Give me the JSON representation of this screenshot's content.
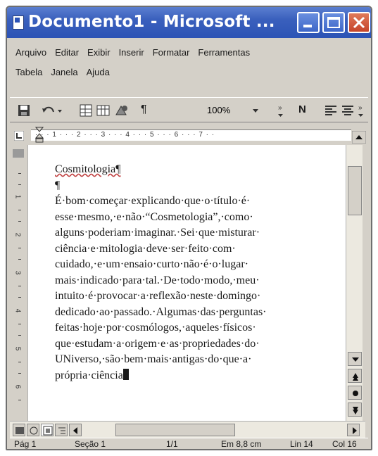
{
  "window": {
    "title": "Documento1 - Microsoft ..."
  },
  "menu": {
    "row1": [
      "Arquivo",
      "Editar",
      "Exibir",
      "Inserir",
      "Formatar",
      "Ferramentas"
    ],
    "row2": [
      "Tabela",
      "Janela",
      "Ajuda"
    ]
  },
  "toolbar": {
    "pilcrow": "¶",
    "zoom": "100%",
    "bold": "N"
  },
  "ruler": {
    "marks": "· · · 1 · · · 2 · · · 3 · · · 4 · · · 5 · · · 6 · · · 7 · ·"
  },
  "vruler": {
    "numbers": [
      "1",
      "2",
      "3",
      "4",
      "5",
      "6"
    ]
  },
  "document": {
    "lines": [
      "Cosmitologia¶",
      "¶",
      "É·bom·começar·explicando·que·o·título·é·",
      "esse·mesmo,·e·não·“Cosmetologia”,·como·",
      "alguns·poderiam·imaginar.·Sei·que·misturar·",
      "ciência·e·mitologia·deve·ser·feito·com·",
      "cuidado,·e·um·ensaio·curto·não·é·o·lugar·",
      "mais·indicado·para·tal.·De·todo·modo,·meu·",
      "intuito·é·provocar·a·reflexão·neste·domingo·",
      "dedicado·ao·passado.·Algumas·das·perguntas·",
      "feitas·hoje·por·cosmólogos,·aqueles·físicos·",
      "que·estudam·a·origem·e·as·propriedades·do·",
      "UNiverso,·são·bem·mais·antigas·do·que·a·",
      "própria·ciência"
    ]
  },
  "statusbar": {
    "page": "Pág 1",
    "section": "Seção 1",
    "pages": "1/1",
    "position": "Em 8,8 cm",
    "line": "Lin 14",
    "column": "Col 16"
  }
}
